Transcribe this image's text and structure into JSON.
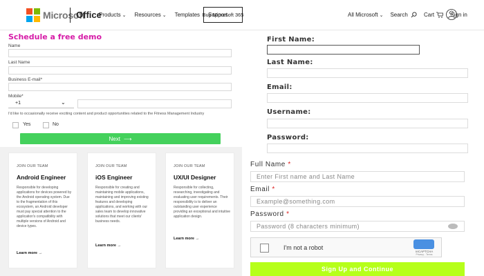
{
  "header": {
    "brand": "Microsoft",
    "product": "Office",
    "nav": [
      "Products",
      "Resources",
      "Templates",
      "Support"
    ],
    "buy_button": "Buy Microsoft 365",
    "all_microsoft": "All Microsoft",
    "search": "Search",
    "cart": "Cart",
    "sign_in": "Sign in",
    "logo_colors": [
      "#f25022",
      "#7fba00",
      "#00a4ef",
      "#ffb900"
    ]
  },
  "demo_form": {
    "title": "Schedule a free demo",
    "name_label": "Name",
    "last_name_label": "Last Name",
    "business_email_label": "Business E-mail*",
    "mobile_label": "Mobile*",
    "country_code": "+1",
    "consent_text": "I'd like to occasionally receive exciting content and product opportunities related to the Fitness Management Industry",
    "yes_label": "Yes",
    "no_label": "No",
    "next_button": "Next",
    "accent_color": "#d61ba7",
    "button_color": "#44d15c"
  },
  "cards": [
    {
      "eyebrow": "JOIN OUR TEAM",
      "title": "Android Engineer",
      "description": "Responsible for developing applications for devices powered by the Android operating system. Due to the fragmentation of this ecosystem, an Android developer must pay special attention to the application's compatibility with multiple versions of Android and device types.",
      "link": "Learn more"
    },
    {
      "eyebrow": "JOIN OUR TEAM",
      "title": "iOS Engineer",
      "description": "Responsible for creating and maintaining mobile applications, maintaining and improving existing features and developing applications, and working with our sales team to develop innovative solutions that meet our clients' business needs.",
      "link": "Learn more"
    },
    {
      "eyebrow": "JOIN OUR TEAM",
      "title": "UX/UI Designer",
      "description": "Responsible for collecting, researching, investigating and evaluating user requirements. Their responsibility is to deliver an outstanding user experience providing an exceptional and intuitive application design.",
      "link": "Learn more"
    }
  ],
  "register_form": {
    "first_name_label": "First Name:",
    "last_name_label": "Last Name:",
    "email_label": "Email:",
    "username_label": "Username:",
    "password_label": "Password:"
  },
  "signup_form": {
    "full_name_label": "Full Name",
    "full_name_placeholder": "Enter First name and Last Name",
    "email_label": "Email",
    "email_placeholder": "Example@something.com",
    "password_label": "Password",
    "password_placeholder": "Password (8 characters minimum)",
    "required_mark": "*",
    "captcha_label": "I'm not a robot",
    "captcha_brand": "reCAPTCHA",
    "captcha_links": "Privacy - Terms",
    "submit_button": "Sign Up and Continue",
    "button_color": "#b6ff1a"
  }
}
